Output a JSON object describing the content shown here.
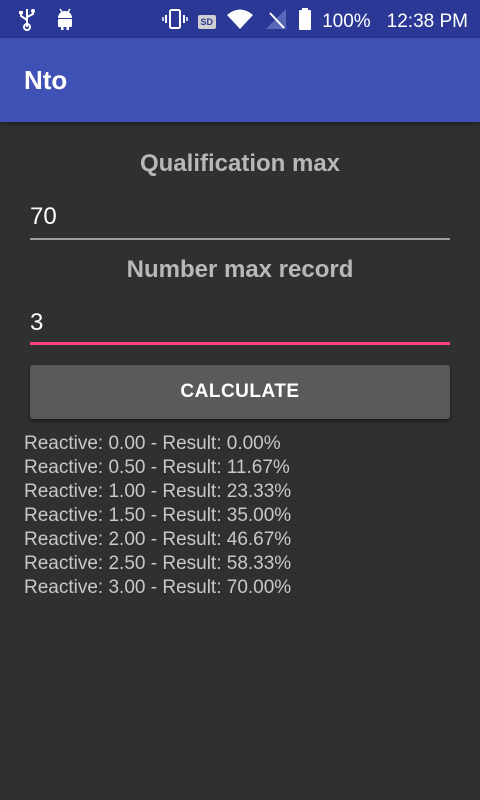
{
  "status_bar": {
    "battery_percent": "100%",
    "time": "12:38 PM",
    "sd_label": "SD",
    "icons": [
      "usb-icon",
      "android-icon",
      "vibrate-icon",
      "sd-card-icon",
      "wifi-icon",
      "no-signal-icon",
      "battery-icon"
    ]
  },
  "app_bar": {
    "title": "Nto"
  },
  "form": {
    "qualification_label": "Qualification max",
    "qualification_value": "70",
    "records_label": "Number max record",
    "records_value": "3",
    "calculate_label": "CALCULATE"
  },
  "results": [
    "Reactive: 0.00 - Result: 0.00%",
    "Reactive: 0.50 - Result: 11.67%",
    "Reactive: 1.00 - Result: 23.33%",
    "Reactive: 1.50 - Result: 35.00%",
    "Reactive: 2.00 - Result: 46.67%",
    "Reactive: 2.50 - Result: 58.33%",
    "Reactive: 3.00 - Result: 70.00%"
  ],
  "colors": {
    "status_bar": "#2c3895",
    "app_bar": "#3f51b5",
    "background": "#303030",
    "accent": "#ff4081",
    "button": "#5a5a5a"
  }
}
